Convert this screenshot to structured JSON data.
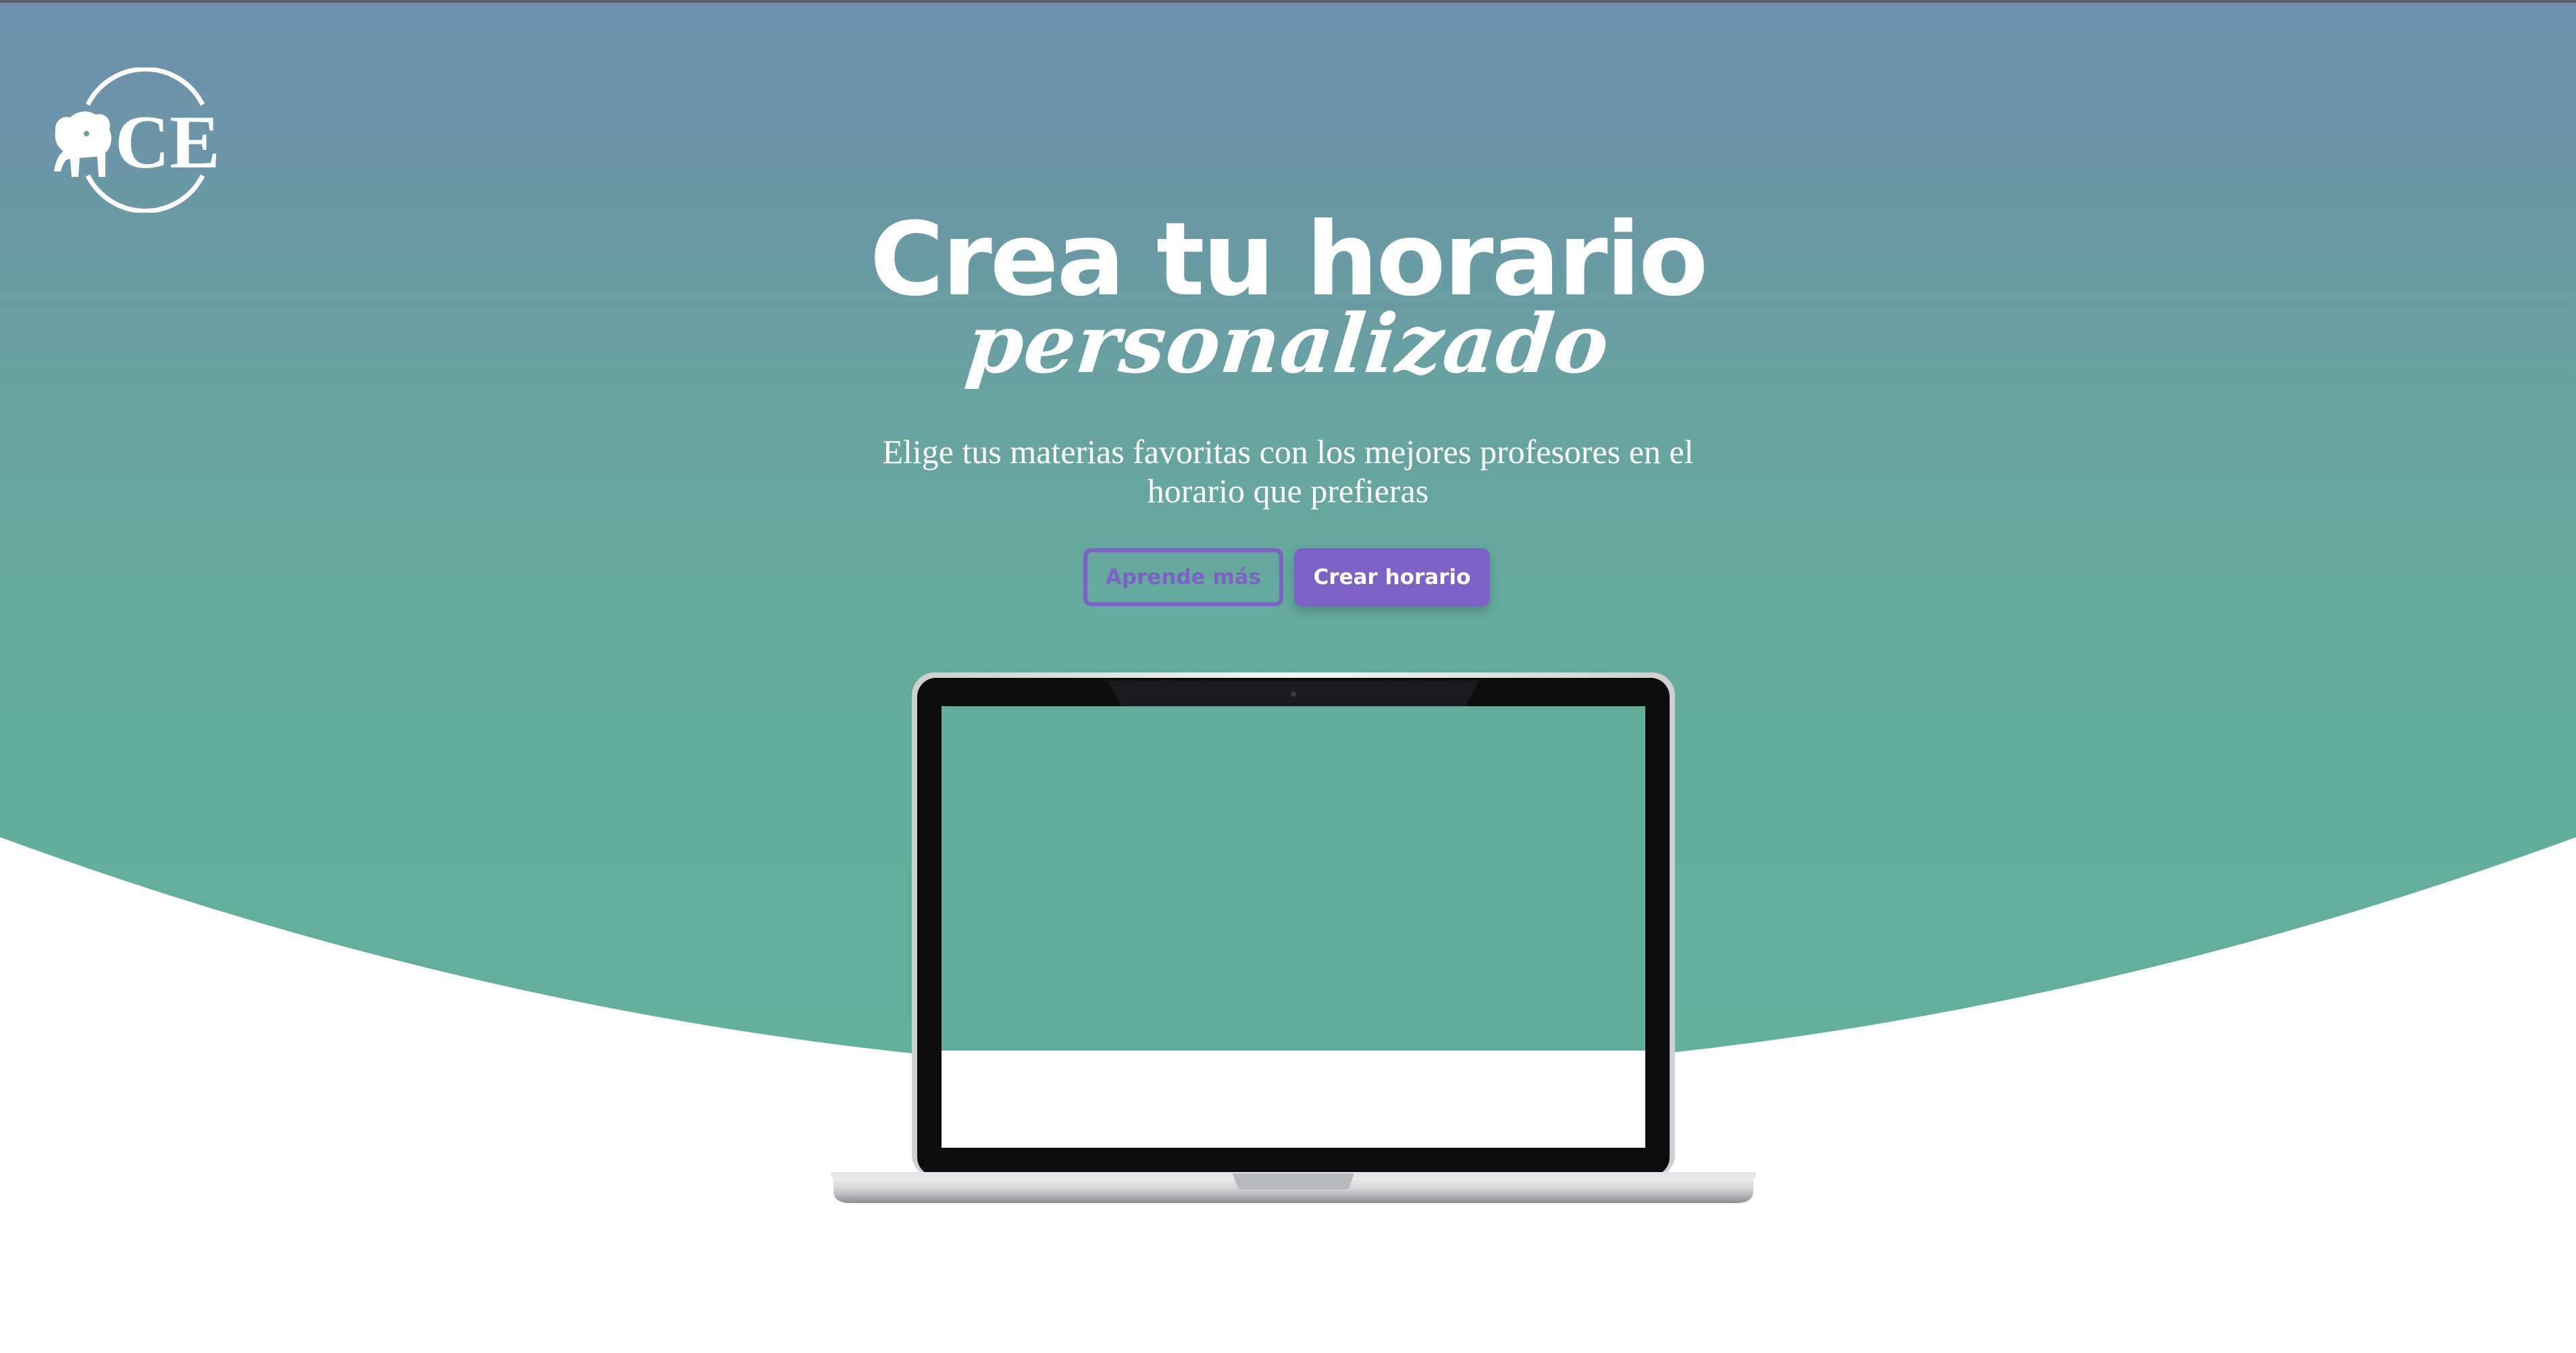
{
  "logo": {
    "text": "CE",
    "icon": "pug-dog-icon"
  },
  "hero": {
    "title": "Crea tu horario",
    "script": "personalizado",
    "subtitle": "Elige tus materias favoritas con los mejores profesores en el horario que prefieras"
  },
  "buttons": {
    "learn_more": "Aprende más",
    "create": "Crear horario"
  },
  "colors": {
    "gradient_top": "#6f8fab",
    "gradient_bottom": "#63b09b",
    "accent": "#7b62c4",
    "background": "#ffffff"
  },
  "device": {
    "icon": "laptop-mockup-icon"
  }
}
